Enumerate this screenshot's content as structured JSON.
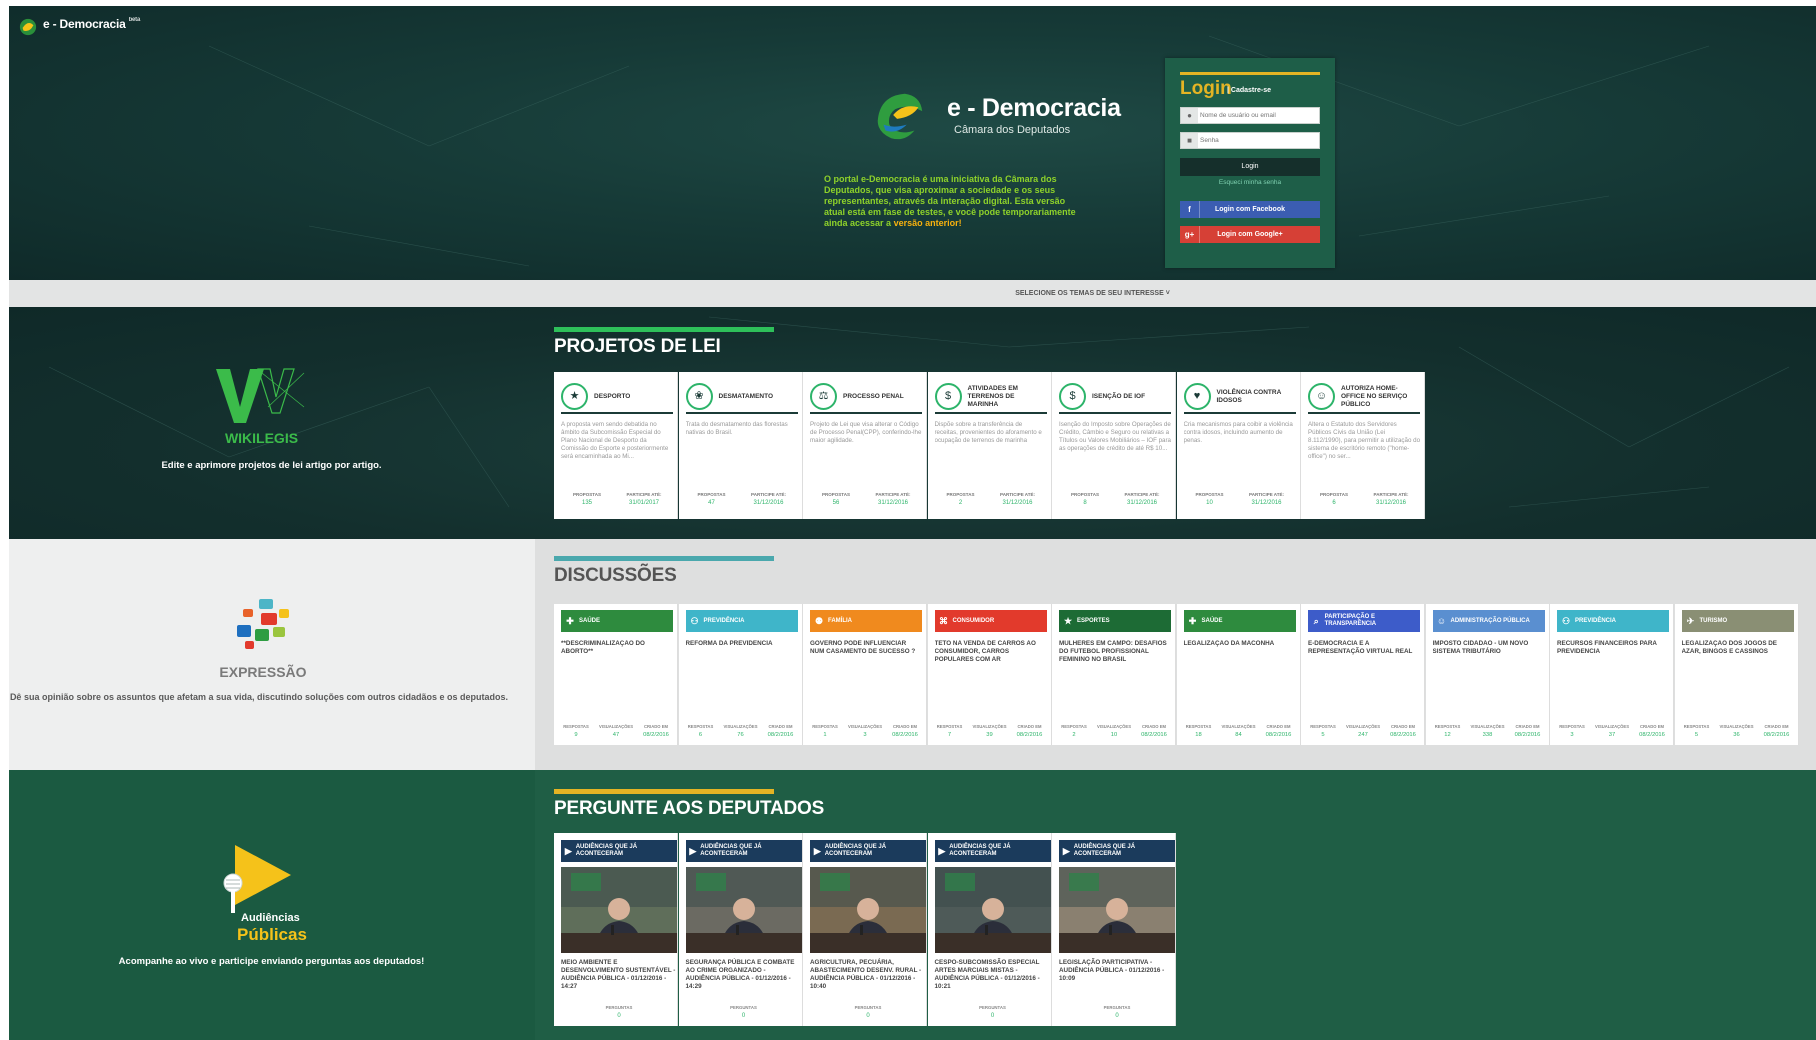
{
  "topbar": {
    "title": "e - Democracia",
    "beta": "beta"
  },
  "hero": {
    "brand_title": "e - Democracia",
    "brand_subtitle": "Câmara dos Deputados",
    "intro_1": "O portal e-Democracia é uma iniciativa da Câmara dos Deputados, que visa aproximar a sociedade e os seus representantes, através da interação digital. Esta versão atual está em fase de testes, e você pode temporariamente ainda acessar a ",
    "intro_link": "versão anterior!"
  },
  "login": {
    "title": "Login",
    "register": "Cadastre-se",
    "user_placeholder": "Nome de usuário ou email",
    "password_placeholder": "Senha",
    "button": "Login",
    "forgot": "Esqueci minha senha",
    "facebook": "Login com Facebook",
    "google": "Login com Google+"
  },
  "themes_bar": {
    "label": "SELECIONE OS TEMAS DE SEU INTERESSE ˅"
  },
  "wikilegis": {
    "name": "WIKILEGIS",
    "caption": "Edite e aprimore projetos de lei artigo por artigo.",
    "section_title": "PROJETOS DE LEI"
  },
  "projetos": [
    {
      "theme": "DESPORTO",
      "icon": "runner-icon",
      "desc": "A proposta vem sendo debatida no âmbito da Subcomissão Especial do Plano Nacional de Desporto da Comissão do Esporte e posteriormente será encaminhada ao Mi...",
      "k1": "PROPOSTAS",
      "v1": "135",
      "k2": "PARTICIPE ATÉ:",
      "v2": "31/01/2017"
    },
    {
      "theme": "DESMATAMENTO",
      "icon": "leaf-icon",
      "desc": "Trata do desmatamento das florestas nativas do Brasil.",
      "k1": "PROPOSTAS",
      "v1": "47",
      "k2": "PARTICIPE ATÉ:",
      "v2": "31/12/2016"
    },
    {
      "theme": "PROCESSO PENAL",
      "icon": "scale-icon",
      "desc": "Projeto de Lei que visa alterar o Código de Processo Penal(CPP), conferindo-lhe maior agilidade.",
      "k1": "PROPOSTAS",
      "v1": "56",
      "k2": "PARTICIPE ATÉ:",
      "v2": "31/12/2016"
    },
    {
      "theme": "ATIVIDADES EM TERRENOS DE MARINHA",
      "icon": "money-icon",
      "desc": "Dispõe sobre a transferência de receitas, provenientes do aforamento e ocupação de terrenos de marinha",
      "k1": "PROPOSTAS",
      "v1": "2",
      "k2": "PARTICIPE ATÉ:",
      "v2": "31/12/2016"
    },
    {
      "theme": "ISENÇÃO DE IOF",
      "icon": "moneybag-icon",
      "desc": "Isenção do Imposto sobre Operações de Crédito, Câmbio e Seguro ou relativas a Títulos ou Valores Mobiliários – IOF para as operações de crédito de até R$ 10...",
      "k1": "PROPOSTAS",
      "v1": "8",
      "k2": "PARTICIPE ATÉ:",
      "v2": "31/12/2016"
    },
    {
      "theme": "VIOLÊNCIA CONTRA IDOSOS",
      "icon": "heart-hand-icon",
      "desc": "Cria mecanismos para coibir a violência contra idosos, incluindo aumento de penas.",
      "k1": "PROPOSTAS",
      "v1": "10",
      "k2": "PARTICIPE ATÉ:",
      "v2": "31/12/2016"
    },
    {
      "theme": "AUTORIZA HOME-OFFICE NO SERVIÇO PÚBLICO",
      "icon": "person-icon",
      "desc": "Altera o Estatuto dos Servidores Públicos Civis da União (Lei 8.112/1990), para permitir a utilização do sistema de escritório remoto (\"home-office\") no ser...",
      "k1": "PROPOSTAS",
      "v1": "6",
      "k2": "PARTICIPE ATÉ:",
      "v2": "31/12/2016"
    }
  ],
  "expressao": {
    "name": "EXPRESSÃO",
    "caption": "Dê sua opinião sobre os assuntos que afetam a sua vida, discutindo soluções com outros cidadãos e os deputados.",
    "section_title": "DISCUSSÕES"
  },
  "stat_labels": {
    "respostas": "RESPOSTAS",
    "visualizacoes": "VISUALIZAÇÕES",
    "criado": "CRIADO EM"
  },
  "discussoes": [
    {
      "cat": "SAÚDE",
      "color": "#2e8b3e",
      "icon": "hospital-icon",
      "title": "**DESCRIMINALIZAÇÃO DO ABORTO**",
      "r": "9",
      "vz": "47",
      "c": "08/2/2016"
    },
    {
      "cat": "PREVIDÊNCIA",
      "color": "#3fb5c9",
      "icon": "people-icon",
      "title": "REFORMA DA PREVIDENCIA",
      "r": "6",
      "vz": "76",
      "c": "08/2/2016"
    },
    {
      "cat": "FAMÍLIA",
      "color": "#f08a1e",
      "icon": "family-icon",
      "title": "GOVERNO PODE INFLUENCIAR NUM CASAMENTO DE SUCESSO ?",
      "r": "1",
      "vz": "3",
      "c": "08/2/2016"
    },
    {
      "cat": "CONSUMIDOR",
      "color": "#e23a2c",
      "icon": "cart-icon",
      "title": "TETO NA VENDA DE CARROS AO CONSUMIDOR, CARROS POPULARES COM AR",
      "r": "7",
      "vz": "39",
      "c": "08/2/2016"
    },
    {
      "cat": "ESPORTES",
      "color": "#1d6b35",
      "icon": "runner-icon",
      "title": "MULHERES EM CAMPO: DESAFIOS DO FUTEBOL PROFISSIONAL FEMININO NO BRASIL",
      "r": "2",
      "vz": "10",
      "c": "08/2/2016"
    },
    {
      "cat": "SAÚDE",
      "color": "#2e8b3e",
      "icon": "hospital-icon",
      "title": "LEGALIZAÇÃO DA MACONHA",
      "r": "18",
      "vz": "84",
      "c": "08/2/2016"
    },
    {
      "cat": "PARTICIPAÇÃO E TRANSPARÊNCIA",
      "color": "#3d5cc9",
      "icon": "magnifier-icon",
      "title": "E-DEMOCRACIA E A REPRESENTAÇÃO VIRTUAL REAL",
      "r": "5",
      "vz": "247",
      "c": "08/2/2016"
    },
    {
      "cat": "ADMINISTRAÇÃO PÚBLICA",
      "color": "#5a8fd0",
      "icon": "admin-icon",
      "title": "IMPOSTO CIDADÃO - UM NOVO SISTEMA TRIBUTÁRIO",
      "r": "12",
      "vz": "338",
      "c": "08/2/2016"
    },
    {
      "cat": "PREVIDÊNCIA",
      "color": "#3fb5c9",
      "icon": "people-icon",
      "title": "RECURSOS FINANCEIROS PARA PREVIDENCIA",
      "r": "3",
      "vz": "37",
      "c": "08/2/2016"
    },
    {
      "cat": "TURISMO",
      "color": "#8a8f74",
      "icon": "traveler-icon",
      "title": "LEGALIZAÇÃO DOS JOGOS DE AZAR, BINGOS E CASSINOS",
      "r": "5",
      "vz": "36",
      "c": "08/2/2016"
    }
  ],
  "audiencias": {
    "name_1": "Audiências",
    "name_2": "Públicas",
    "caption": "Acompanhe ao vivo e participe enviando perguntas aos deputados!",
    "section_title": "PERGUNTE AOS DEPUTADOS"
  },
  "audiencias_cards": [
    {
      "head": "AUDIÊNCIAS QUE JÁ ACONTECERAM",
      "title": "MEIO AMBIENTE E DESENVOLVIMENTO SUSTENTÁVEL - AUDIÊNCIA PÚBLICA - 01/12/2016 - 14:27",
      "k": "PERGUNTAS",
      "v": "0"
    },
    {
      "head": "AUDIÊNCIAS QUE JÁ ACONTECERAM",
      "title": "SEGURANÇA PÚBLICA E COMBATE AO CRIME ORGANIZADO - AUDIÊNCIA PÚBLICA - 01/12/2016 - 14:29",
      "k": "PERGUNTAS",
      "v": "0"
    },
    {
      "head": "AUDIÊNCIAS QUE JÁ ACONTECERAM",
      "title": "AGRICULTURA, PECUÁRIA, ABASTECIMENTO DESENV. RURAL - AUDIÊNCIA PÚBLICA - 01/12/2016 - 10:40",
      "k": "PERGUNTAS",
      "v": "0"
    },
    {
      "head": "AUDIÊNCIAS QUE JÁ ACONTECERAM",
      "title": "CESPO-SUBCOMISSÃO ESPECIAL ARTES MARCIAIS MISTAS - AUDIÊNCIA PÚBLICA - 01/12/2016 - 10:21",
      "k": "PERGUNTAS",
      "v": "0"
    },
    {
      "head": "AUDIÊNCIAS QUE JÁ ACONTECERAM",
      "title": "LEGISLAÇÃO PARTICIPATIVA - AUDIÊNCIA PÚBLICA - 01/12/2016 - 10:09",
      "k": "PERGUNTAS",
      "v": "0"
    }
  ]
}
